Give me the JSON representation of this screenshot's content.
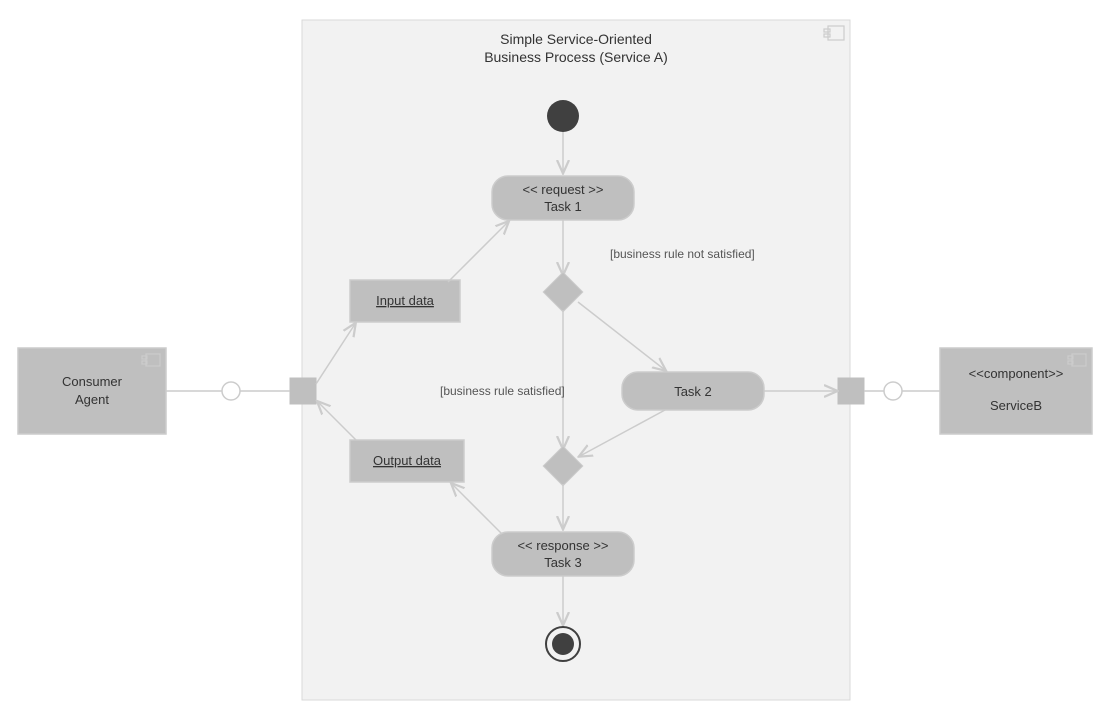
{
  "title": {
    "line1": "Simple Service-Oriented",
    "line2": "Business Process (Service A)"
  },
  "consumer": {
    "name": "Consumer",
    "sub": "Agent"
  },
  "serviceB": {
    "stereotype": "<<component>>",
    "name": "ServiceB"
  },
  "task1": {
    "stereotype": "<< request >>",
    "name": "Task 1"
  },
  "task2": {
    "name": "Task 2"
  },
  "task3": {
    "stereotype": "<< response >>",
    "name": "Task 3"
  },
  "inputData": "Input data",
  "outputData": "Output data",
  "guard1": "[business rule not satisfied]",
  "guard2": "[business rule satisfied]"
}
